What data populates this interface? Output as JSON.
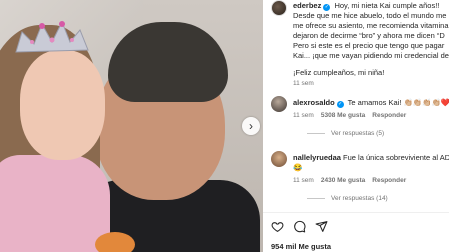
{
  "post": {
    "username": "ederbez",
    "caption_lines": [
      "Hoy, mi nieta Kai cumple años!!",
      "Desde que me hice abuelo, todo el mundo me",
      "me ofrece su asiento, me recomienda vitamina",
      "dejaron de decirme “bro” y ahora me dicen “D",
      "Pero si este es el precio que tengo que pagar",
      "Kai... ¡que me vayan pidiendo mi credencial de"
    ],
    "time": "11 sem",
    "closing_line": "¡Feliz cumpleaños, mi niña!",
    "closing_time": "11 sem"
  },
  "comments": [
    {
      "username": "alexrosaldo",
      "text": "Te amamos Kai!",
      "emojis": "👏🏼👏🏼👏🏼👏🏼❤️❤️",
      "time": "11 sem",
      "likes": "5308 Me gusta",
      "reply": "Responder",
      "view_replies": "Ver respuestas (5)"
    },
    {
      "username": "nallelyruedaa",
      "text": "Fue la única sobreviviente al AD",
      "emojis": "😂",
      "time": "11 sem",
      "likes": "2430 Me gusta",
      "reply": "Responder",
      "view_replies": "Ver respuestas (14)"
    }
  ],
  "footer": {
    "likes": "954 mil Me gusta"
  },
  "icons": {
    "next": "chevron-right-icon",
    "like": "heart-icon",
    "comment": "comment-icon",
    "share": "share-icon"
  }
}
